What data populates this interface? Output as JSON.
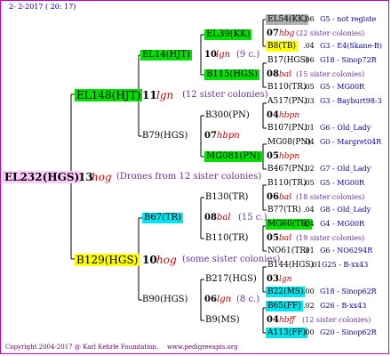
{
  "header": {
    "date": "2-  2-2017 ( 20: 17)"
  },
  "footer": {
    "copyright": "Copyright 2004-2017 @ Karl Kehrle Foundation.",
    "site": "www.pedigreeapis.org"
  },
  "root": {
    "name": "EL232(HGS)",
    "num": "13",
    "abbr": "hog",
    "note": "(Drones from 12 sister colonies)"
  },
  "gen1": [
    {
      "name": "EL148(HJT)",
      "num": "11",
      "abbr": "lgn",
      "note": "(12 sister colonies)"
    },
    {
      "name": "B129(HGS)",
      "num": "10",
      "abbr": "hog",
      "note": "(some sister colonies)"
    }
  ],
  "gen2": [
    {
      "name": "EL14(HJT)",
      "num": "10",
      "abbr": "lgn",
      "note": "(9 c.)"
    },
    {
      "name": "B79(HGS)",
      "num": "07",
      "abbr": "hbpn",
      "note": ""
    },
    {
      "name": "B67(TR)",
      "num": "08",
      "abbr": "bal",
      "note": "(15 c.)"
    },
    {
      "name": "B90(HGS)",
      "num": "06",
      "abbr": "lgn",
      "note": "(8 c.)"
    }
  ],
  "gen3": [
    {
      "name": "EL39(KK)"
    },
    {
      "name": "B115(HGS)"
    },
    {
      "name": "B300(PN)"
    },
    {
      "name": "MG081(PN)"
    },
    {
      "name": "B130(TR)"
    },
    {
      "name": "B110(TR)"
    },
    {
      "name": "B217(HGS)"
    },
    {
      "name": "B9(MS)"
    }
  ],
  "gen4": [
    {
      "name": "EL54(KK)",
      "val": ".06",
      "gen": "G5 - not registe"
    },
    {
      "row": "07",
      "abbr": "hbg",
      "note": "(22 sister colonies)"
    },
    {
      "name": "B8(TB)",
      "val": ".04",
      "gen": "G3 - E4(Skane-B)"
    },
    {
      "name": "B17(HGS)",
      "val": ".06",
      "gen": "G18 - Sinop72R"
    },
    {
      "row": "08",
      "abbr": "bal",
      "note": "(15 sister colonies)"
    },
    {
      "name": "B110(TR)",
      "val": ".05",
      "gen": "G5 - MG00R"
    },
    {
      "name": "A517(PN)",
      "val": ".03",
      "gen": "G3 - Bayburt98-3"
    },
    {
      "row": "04",
      "abbr": "hbpn",
      "note": ""
    },
    {
      "name": "B107(PN)",
      "val": ".01",
      "gen": "G6 - Old_Lady"
    },
    {
      "name": "MG08(PN)",
      "val": ".04",
      "gen": "G0 - Margret04R"
    },
    {
      "row": "05",
      "abbr": "hbpn",
      "note": ""
    },
    {
      "name": "B467(PN)",
      "val": ".02",
      "gen": "G7 - Old_Lady"
    },
    {
      "name": "B110(TR)",
      "val": ".05",
      "gen": "G5 - MG00R"
    },
    {
      "row": "06",
      "abbr": "bal",
      "note": "(18 sister colonies)"
    },
    {
      "name": "B77(TR)",
      "val": ".04",
      "gen": "G8 - Old_Lady"
    },
    {
      "name": "MG60(TR)",
      "val": ".04",
      "gen": "G4 - MG00R"
    },
    {
      "row": "05",
      "abbr": "bal",
      "note": "(19 sister colonies)"
    },
    {
      "name": "NO61(TR)",
      "val": ".01",
      "gen": "G6 - NO6294R"
    },
    {
      "name": "B144(HGS)",
      "val": ".01",
      "gen": "G25 - B-xx43"
    },
    {
      "row": "03",
      "abbr": "lgn",
      "note": ""
    },
    {
      "name": "B22(MS)",
      "val": ".00",
      "gen": "G18 - Sinop62R"
    },
    {
      "name": "B65(FF)",
      "val": ".02",
      "gen": "G26 - B-xx43"
    },
    {
      "row": "04",
      "abbr": "hbff",
      "note": "(12 sister colonies)"
    },
    {
      "name": "A113(FF)",
      "val": ".00",
      "gen": "G20 - Sinop62R"
    }
  ],
  "colors": {
    "frame": "#c000c0",
    "green": "#00e000",
    "cyan": "#00e6f0",
    "yellow": "#ffff00",
    "pink": "#ffccff",
    "red": "#cc0000"
  }
}
